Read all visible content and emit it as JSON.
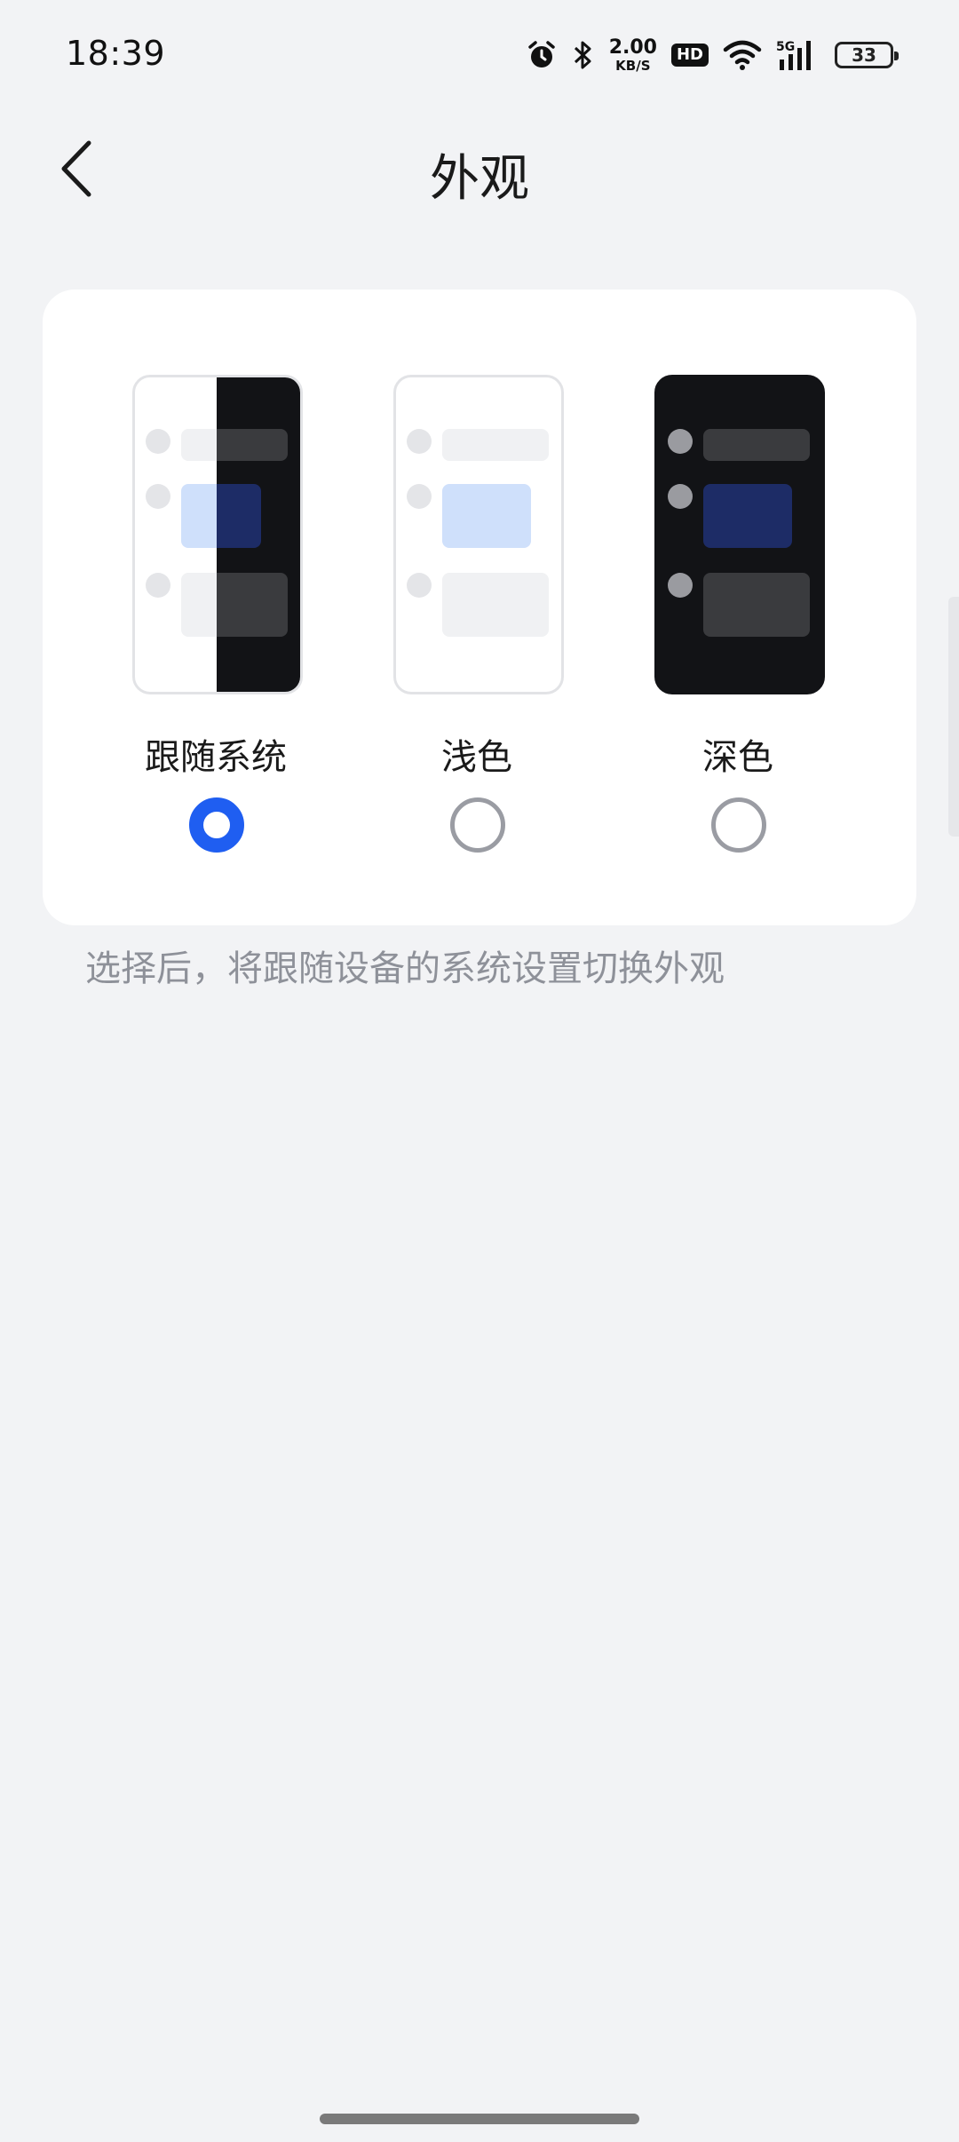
{
  "status_bar": {
    "time": "18:39",
    "net_speed_value": "2.00",
    "net_speed_unit": "KB/S",
    "hd_label": "HD",
    "signal_label": "5G",
    "battery_level": "33",
    "icons": [
      "alarm-icon",
      "bluetooth-icon",
      "hd-icon",
      "wifi-icon",
      "signal-5g-icon",
      "battery-icon"
    ]
  },
  "header": {
    "title": "外观",
    "back_icon": "chevron-left-icon"
  },
  "appearance": {
    "options": [
      {
        "label": "跟随系统",
        "selected": true
      },
      {
        "label": "浅色",
        "selected": false
      },
      {
        "label": "深色",
        "selected": false
      }
    ],
    "hint": "选择后，将跟随设备的系统设置切换外观"
  },
  "colors": {
    "accent": "#1f5ef1",
    "background": "#f2f3f5",
    "card": "#ffffff",
    "dark_preview": "#121316",
    "hint_text": "#8e9199"
  }
}
